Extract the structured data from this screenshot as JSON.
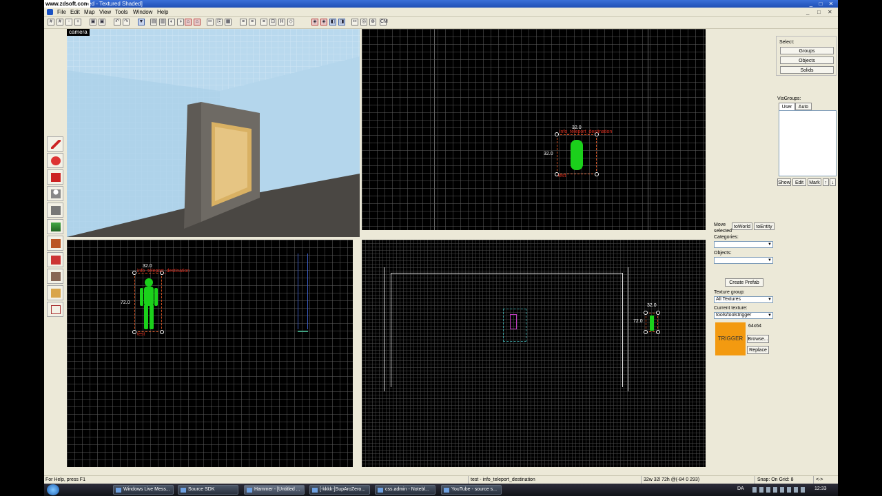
{
  "window": {
    "url_overlay": "www.zdsoft.com",
    "title": "ted - Textured Shaded]",
    "controls": [
      "_",
      "□",
      "✕"
    ]
  },
  "menu": [
    "File",
    "Edit",
    "Map",
    "View",
    "Tools",
    "Window",
    "Help"
  ],
  "mdi_controls": [
    "_",
    "□",
    "✕"
  ],
  "viewports": {
    "camera_label": "camera",
    "top": {
      "entity_label": "info_teleport_destination",
      "width_label": "32.0",
      "height_label": "32.0",
      "name_tag": "test"
    },
    "front": {
      "entity_label": "info_teleport_destination",
      "width_label": "32.0",
      "height_label": "72.0",
      "name_tag": "test"
    },
    "side": {
      "width_label": "32.0",
      "height_label": "72.0"
    }
  },
  "right_panel": {
    "select_label": "Select:",
    "select_buttons": [
      "Groups",
      "Objects",
      "Solids"
    ],
    "visgroups_label": "VisGroups:",
    "visgroup_tabs": [
      "User",
      "Auto"
    ],
    "visgroup_buttons": [
      "Show",
      "Edit",
      "Mark",
      "↑",
      "↓"
    ],
    "move_selected": "Move selected",
    "to_world": "toWorld",
    "to_entity": "toEntity",
    "categories_label": "Categories:",
    "objects_label": "Objects:",
    "create_prefab": "Create Prefab",
    "texture_group_label": "Texture group:",
    "texture_group_value": "All Textures",
    "current_texture_label": "Current texture:",
    "current_texture_value": "tools/toolstrigger",
    "texture_size": "64x64",
    "texture_preview_text": "TRIGGER",
    "texture_preview_color": "#f39a10",
    "browse_button": "Browse...",
    "replace_button": "Replace"
  },
  "status_bar": {
    "help": "For Help, press F1",
    "selection": "test - info_teleport_destination",
    "coords": "32w 32l 72h @(-84 0 293)",
    "snap": "Snap: On Grid: 8",
    "extra": "<->"
  },
  "taskbar": {
    "items": [
      "Windows Live Mess...",
      "Source SDK",
      "Hammer - [Untitled ...",
      "[-kkkk-]SupAroZero...",
      "css.admin - Notebl...",
      "YouTube - source s..."
    ],
    "active_index": 2,
    "lang": "DA",
    "clock": "12:33"
  }
}
